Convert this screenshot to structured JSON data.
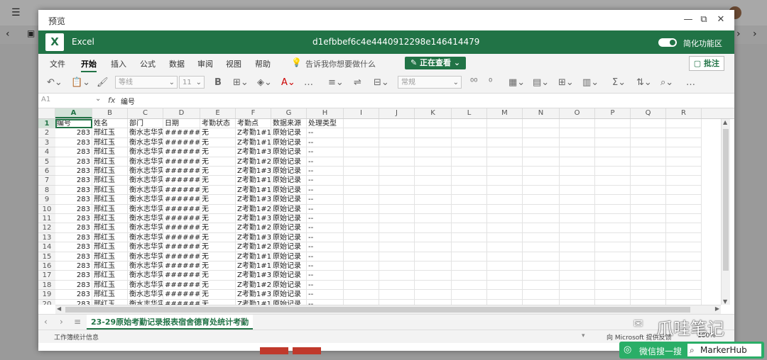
{
  "dialog": {
    "title": "预览"
  },
  "excel": {
    "app_name": "Excel",
    "file_name": "d1efbbef6c4e4440912298e146414479",
    "simplified_ribbon": "简化功能区"
  },
  "menu": {
    "items": [
      "文件",
      "开始",
      "插入",
      "公式",
      "数据",
      "审阅",
      "视图",
      "帮助"
    ],
    "active": "开始",
    "tell_me": "告诉我你想要做什么",
    "viewing": "正在查看",
    "comments": "批注"
  },
  "toolbar": {
    "font_name": "等线",
    "font_size": "11",
    "number_format": "常规"
  },
  "formula_bar": {
    "name_box": "A1",
    "fx": "fx",
    "value": "编号"
  },
  "grid": {
    "columns": [
      "A",
      "B",
      "C",
      "D",
      "E",
      "F",
      "G",
      "H",
      "I",
      "J",
      "K",
      "L",
      "M",
      "N",
      "O",
      "P",
      "Q",
      "R"
    ],
    "row_numbers": [
      "1",
      "2",
      "3",
      "4",
      "5",
      "6",
      "7",
      "8",
      "9",
      "10",
      "11",
      "12",
      "13",
      "14",
      "15",
      "16",
      "17",
      "18",
      "19",
      "20"
    ],
    "headers": [
      "编号",
      "姓名",
      "部门",
      "日期",
      "考勤状态",
      "考勤点",
      "数据来源",
      "处理类型"
    ],
    "rows": [
      [
        "283",
        "邢红玉",
        "衡水志华实",
        "#######",
        "无",
        "Z考勤1#1F",
        "原始记录",
        "--"
      ],
      [
        "283",
        "邢红玉",
        "衡水志华实",
        "#######",
        "无",
        "Z考勤1#1F",
        "原始记录",
        "--"
      ],
      [
        "283",
        "邢红玉",
        "衡水志华实",
        "#######",
        "无",
        "Z考勤1#3F",
        "原始记录",
        "--"
      ],
      [
        "283",
        "邢红玉",
        "衡水志华实",
        "#######",
        "无",
        "Z考勤1#2F",
        "原始记录",
        "--"
      ],
      [
        "283",
        "邢红玉",
        "衡水志华实",
        "#######",
        "无",
        "Z考勤1#3F",
        "原始记录",
        "--"
      ],
      [
        "283",
        "邢红玉",
        "衡水志华实",
        "#######",
        "无",
        "Z考勤1#1F",
        "原始记录",
        "--"
      ],
      [
        "283",
        "邢红玉",
        "衡水志华实",
        "#######",
        "无",
        "Z考勤1#1F",
        "原始记录",
        "--"
      ],
      [
        "283",
        "邢红玉",
        "衡水志华实",
        "#######",
        "无",
        "Z考勤1#3F",
        "原始记录",
        "--"
      ],
      [
        "283",
        "邢红玉",
        "衡水志华实",
        "#######",
        "无",
        "Z考勤1#2F",
        "原始记录",
        "--"
      ],
      [
        "283",
        "邢红玉",
        "衡水志华实",
        "#######",
        "无",
        "Z考勤1#3F",
        "原始记录",
        "--"
      ],
      [
        "283",
        "邢红玉",
        "衡水志华实",
        "#######",
        "无",
        "Z考勤1#2F",
        "原始记录",
        "--"
      ],
      [
        "283",
        "邢红玉",
        "衡水志华实",
        "#######",
        "无",
        "Z考勤1#3F",
        "原始记录",
        "--"
      ],
      [
        "283",
        "邢红玉",
        "衡水志华实",
        "#######",
        "无",
        "Z考勤1#2F",
        "原始记录",
        "--"
      ],
      [
        "283",
        "邢红玉",
        "衡水志华实",
        "#######",
        "无",
        "Z考勤1#1F",
        "原始记录",
        "--"
      ],
      [
        "283",
        "邢红玉",
        "衡水志华实",
        "#######",
        "无",
        "Z考勤1#1F",
        "原始记录",
        "--"
      ],
      [
        "283",
        "邢红玉",
        "衡水志华实",
        "#######",
        "无",
        "Z考勤1#3F",
        "原始记录",
        "--"
      ],
      [
        "283",
        "邢红玉",
        "衡水志华实",
        "#######",
        "无",
        "Z考勤1#2F",
        "原始记录",
        "--"
      ],
      [
        "283",
        "邢红玉",
        "衡水志华实",
        "#######",
        "无",
        "Z考勤1#3F",
        "原始记录",
        "--"
      ],
      [
        "283",
        "邢红玉",
        "衡水志华实",
        "#######",
        "无",
        "Z考勤1#1F",
        "原始记录",
        "--"
      ]
    ]
  },
  "sheet_tab": "23-29原始考勤记录报表宿舍德育处统计考勤",
  "status": {
    "left": "工作簿统计信息",
    "right": "向 Microsoft 提供反馈",
    "zoom": "100%"
  },
  "watermark": {
    "brand": "爪哇笔记",
    "wechat_label": "微信搜一搜",
    "wechat_id": "MarkerHub"
  },
  "colors": {
    "excel_green": "#217346",
    "wechat_green": "#2aae67"
  }
}
